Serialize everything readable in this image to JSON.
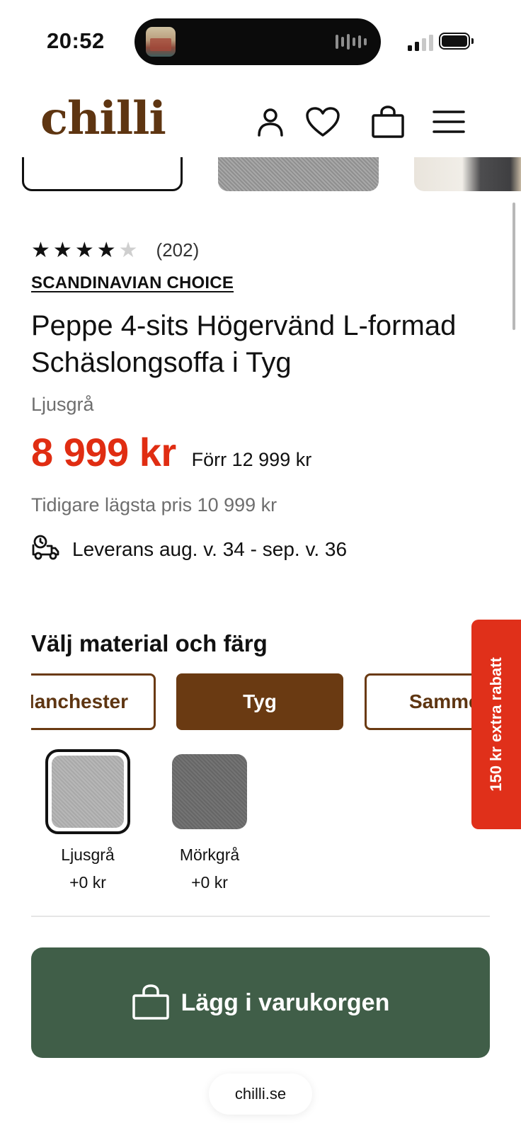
{
  "status_bar": {
    "time": "20:52"
  },
  "header": {
    "logo": "chilli",
    "icons": [
      "account-icon",
      "wishlist-heart-icon",
      "shopping-bag-icon",
      "menu-hamburger-icon"
    ]
  },
  "product": {
    "rating": 4,
    "rating_max": 5,
    "review_count": "(202)",
    "brand": "SCANDINAVIAN CHOICE",
    "title": "Peppe 4-sits Högervänd L-formad Schäslongsoffa i Tyg",
    "variant": "Ljusgrå",
    "price": "8 999 kr",
    "old_price": "Förr 12 999 kr",
    "lowest_price": "Tidigare lägsta pris 10 999 kr",
    "delivery": "Leverans aug. v. 34 - sep. v. 36"
  },
  "material_section": {
    "title": "Välj material och färg",
    "materials": [
      {
        "label": "Manchester",
        "selected": false
      },
      {
        "label": "Tyg",
        "selected": true
      },
      {
        "label": "Sammet",
        "selected": false
      }
    ],
    "swatches": [
      {
        "name": "Ljusgrå",
        "price": "+0 kr",
        "selected": true
      },
      {
        "name": "Mörkgrå",
        "price": "+0 kr",
        "selected": false
      }
    ]
  },
  "cart_button": {
    "label": "Lägg i varukorgen"
  },
  "discount_tab": {
    "label": "150 kr extra rabatt"
  },
  "browser": {
    "url": "chilli.se"
  },
  "colors": {
    "brand_brown": "#6a3a12",
    "price_red": "#e02d12",
    "cart_green": "#405e48",
    "discount_red": "#e0301a"
  }
}
